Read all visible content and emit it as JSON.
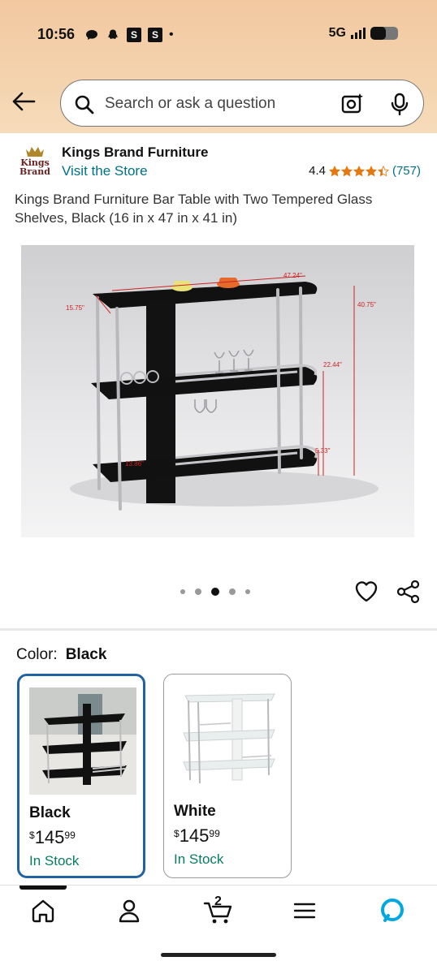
{
  "status_bar": {
    "time": "10:56",
    "icons": [
      "chat-bubble-icon",
      "snapchat-icon",
      "s-app-icon",
      "s-app-icon",
      "dot-icon"
    ],
    "s_label": "S",
    "network": "5G",
    "battery_level_fraction": 0.55
  },
  "search": {
    "placeholder": "Search or ask a question",
    "icons": [
      "search-icon",
      "camera-icon",
      "mic-icon"
    ]
  },
  "brand": {
    "name": "Kings Brand Furniture",
    "visit_link": "Visit the Store",
    "rating": "4.4",
    "review_count": "(757)",
    "stars_fraction": 0.88
  },
  "product": {
    "title": "Kings Brand Furniture Bar Table with Two Tempered Glass Shelves, Black (16 in x 47 in x 41 in)",
    "image_dimension_labels": [
      "47.24\"",
      "40.75\"",
      "15.75\"",
      "22.44\"",
      "5.33\"",
      "13.86\""
    ],
    "image_count": 5,
    "active_image_index": 2
  },
  "color": {
    "label": "Color:",
    "selected": "Black",
    "options": [
      {
        "name": "Black",
        "currency": "$",
        "price_whole": "145",
        "price_fraction": "99",
        "stock": "In Stock",
        "selected": true
      },
      {
        "name": "White",
        "currency": "$",
        "price_whole": "145",
        "price_fraction": "99",
        "stock": "In Stock",
        "selected": false
      }
    ]
  },
  "bottom_nav": {
    "items": [
      "home-icon",
      "account-icon",
      "cart-icon",
      "menu-icon",
      "alexa-icon"
    ],
    "cart_count": "2"
  },
  "colors": {
    "header_bg": "#f4d3ae",
    "link": "#007185",
    "star": "#e47911",
    "in_stock": "#067d62",
    "selected_border": "#2162a1",
    "alexa": "#00a8e1"
  }
}
